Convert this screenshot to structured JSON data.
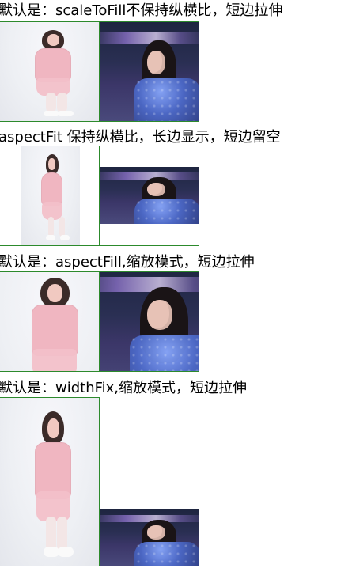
{
  "sections": [
    {
      "title": "默认是：scaleToFill不保持纵横比，短边拉伸"
    },
    {
      "title": "aspectFit 保持纵横比，长边显示，短边留空"
    },
    {
      "title": "默认是：aspectFill,缩放模式，短边拉伸"
    },
    {
      "title": "默认是：widthFix,缩放模式，短边拉伸"
    }
  ],
  "colors": {
    "frame_border": "#2c8a2c"
  }
}
